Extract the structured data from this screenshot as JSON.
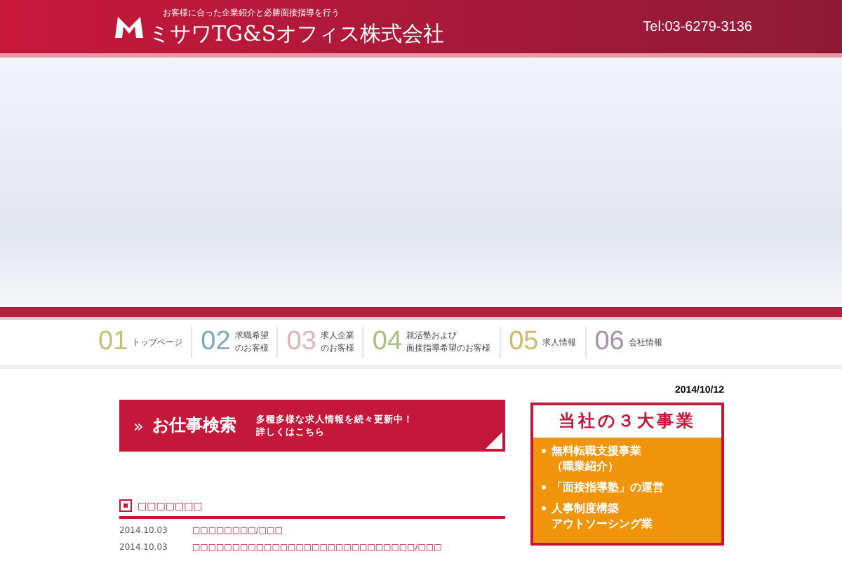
{
  "header": {
    "tagline": "お客様に合った企業紹介と必勝面接指導を行う",
    "logo_text": "ミサワTG&Sオフィス株式会社",
    "phone": "Tel:03-6279-3136"
  },
  "nav": [
    {
      "number": "01",
      "label": [
        "トップページ"
      ],
      "color": "#c2c270"
    },
    {
      "number": "02",
      "label": [
        "求職希望",
        "のお客様"
      ],
      "color": "#7fa9b8"
    },
    {
      "number": "03",
      "label": [
        "求人企業",
        "のお客様"
      ],
      "color": "#d9b5b5"
    },
    {
      "number": "04",
      "label": [
        "就活塾および",
        "面接指導希望のお客様"
      ],
      "color": "#a9bf7f"
    },
    {
      "number": "05",
      "label": [
        "求人情報"
      ],
      "color": "#d4b86a"
    },
    {
      "number": "06",
      "label": [
        "会社情報"
      ],
      "color": "#a890a8"
    }
  ],
  "search_banner": {
    "arrow": "»",
    "title": "お仕事検索",
    "text": [
      "多種多様な求人情報を続々更新中！",
      "詳しくはこちら"
    ]
  },
  "news": {
    "heading": "□□□□□□□",
    "items": [
      {
        "date": "2014.10.03",
        "title": "□□□□□□□□/□□□"
      },
      {
        "date": "2014.10.03",
        "title": "□□□□□□□□□□□□□□□□□□□□□□□□□□□□/□□□"
      }
    ]
  },
  "date": "2014/10/12",
  "business": {
    "title": "当社の３大事業",
    "items": [
      [
        "無料転職支援事業",
        "（職業紹介）"
      ],
      [
        "「面接指導塾」の運営"
      ],
      [
        "人事制度構築",
        "アウトソーシング業"
      ]
    ]
  }
}
